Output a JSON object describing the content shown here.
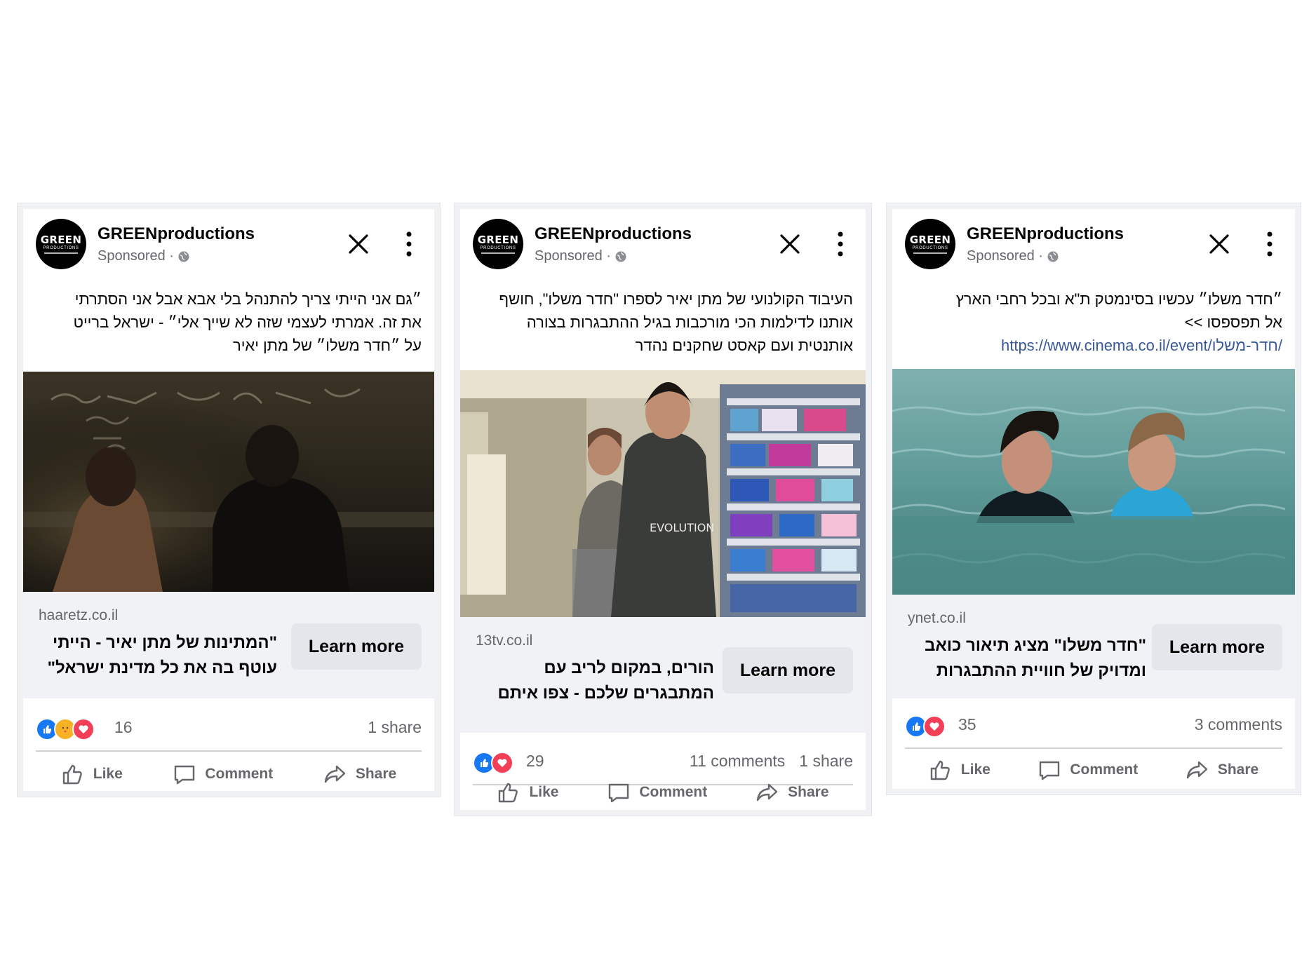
{
  "colors": {
    "brand_blue": "#1877f2",
    "love_red": "#f33e58",
    "link": "#385898",
    "muted": "#65676b",
    "panel": "#f0f2f5"
  },
  "cards": [
    {
      "page_name": "GREENproductions",
      "logo_text": "GREEN",
      "logo_sub": "PRODUCTIONS",
      "sponsored": "Sponsored ·",
      "post_lines": [
        "״גם אני הייתי צריך להתנהל בלי אבא אבל אני הסתרתי",
        "את זה. אמרתי לעצמי שזה לא שייך אלי״ - ישראל ברייט",
        "על ״חדר משלו״ של מתן יאיר"
      ],
      "domain": "haaretz.co.il",
      "headline_lines": [
        "\"המתינות של מתן יאיר - הייתי",
        "עוטף בה את כל מדינת ישראל\""
      ],
      "cta": "Learn more",
      "reaction_count": "16",
      "comments": "",
      "shares": "1 share",
      "actions": {
        "like": "Like",
        "comment": "Comment",
        "share": "Share"
      }
    },
    {
      "page_name": "GREENproductions",
      "logo_text": "GREEN",
      "logo_sub": "PRODUCTIONS",
      "sponsored": "Sponsored ·",
      "post_lines": [
        "העיבוד הקולנועי של מתן יאיר לספרו \"חדר משלו\", חושף",
        "אותנו לדילמות הכי מורכבות בגיל ההתבגרות בצורה",
        "אותנטית ועם קאסט שחקנים נהדר"
      ],
      "domain": "13tv.co.il",
      "headline_lines": [
        "הורים, במקום לריב עם",
        "המתבגרים שלכם - צפו איתם"
      ],
      "cta": "Learn more",
      "reaction_count": "29",
      "comments": "11 comments",
      "shares": "1 share",
      "actions": {
        "like": "Like",
        "comment": "Comment",
        "share": "Share"
      }
    },
    {
      "page_name": "GREENproductions",
      "logo_text": "GREEN",
      "logo_sub": "PRODUCTIONS",
      "sponsored": "Sponsored ·",
      "post_lines": [
        "״חדר משלו״ עכשיו בסינמטק ת\"א ובכל רחבי הארץ",
        "אל תפספסו >>"
      ],
      "post_link": "https://www.cinema.co.il/event/חדר-משלו/",
      "domain": "ynet.co.il",
      "headline_lines": [
        "\"חדר משלו\" מציג תיאור כואב",
        "ומדויק של חוויית ההתבגרות"
      ],
      "cta": "Learn more",
      "reaction_count": "35",
      "comments": "3 comments",
      "shares": "",
      "actions": {
        "like": "Like",
        "comment": "Comment",
        "share": "Share"
      }
    }
  ]
}
